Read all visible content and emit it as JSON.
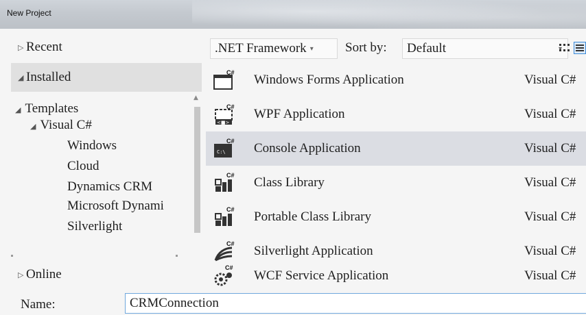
{
  "window": {
    "title": "New Project"
  },
  "leftnav": {
    "recent": "Recent",
    "installed": "Installed",
    "online": "Online",
    "tree": {
      "templates": "Templates",
      "visual_csharp": "Visual C#",
      "children": [
        "Windows",
        "Cloud",
        "Dynamics CRM",
        "Microsoft Dynami",
        "Silverlight"
      ]
    }
  },
  "toolbar": {
    "framework": ".NET Framework",
    "sort_label": "Sort by:",
    "sort_value": "Default"
  },
  "templates": [
    {
      "name": "Windows Forms Application",
      "language": "Visual C#",
      "icon": "windows-forms-icon",
      "selected": false
    },
    {
      "name": "WPF Application",
      "language": "Visual C#",
      "icon": "wpf-icon",
      "selected": false
    },
    {
      "name": "Console Application",
      "language": "Visual C#",
      "icon": "console-icon",
      "selected": true
    },
    {
      "name": "Class Library",
      "language": "Visual C#",
      "icon": "class-library-icon",
      "selected": false
    },
    {
      "name": "Portable Class Library",
      "language": "Visual C#",
      "icon": "portable-class-library-icon",
      "selected": false
    },
    {
      "name": "Silverlight Application",
      "language": "Visual C#",
      "icon": "silverlight-icon",
      "selected": false
    },
    {
      "name": "WCF Service Application",
      "language": "Visual C#",
      "icon": "wcf-service-icon",
      "selected": false
    }
  ],
  "name_field": {
    "label": "Name:",
    "value": "CRMConnection"
  },
  "colors": {
    "selection": "#dbdde3",
    "nav_selection": "#e0e0e0",
    "input_focus": "#6fa7dd"
  }
}
